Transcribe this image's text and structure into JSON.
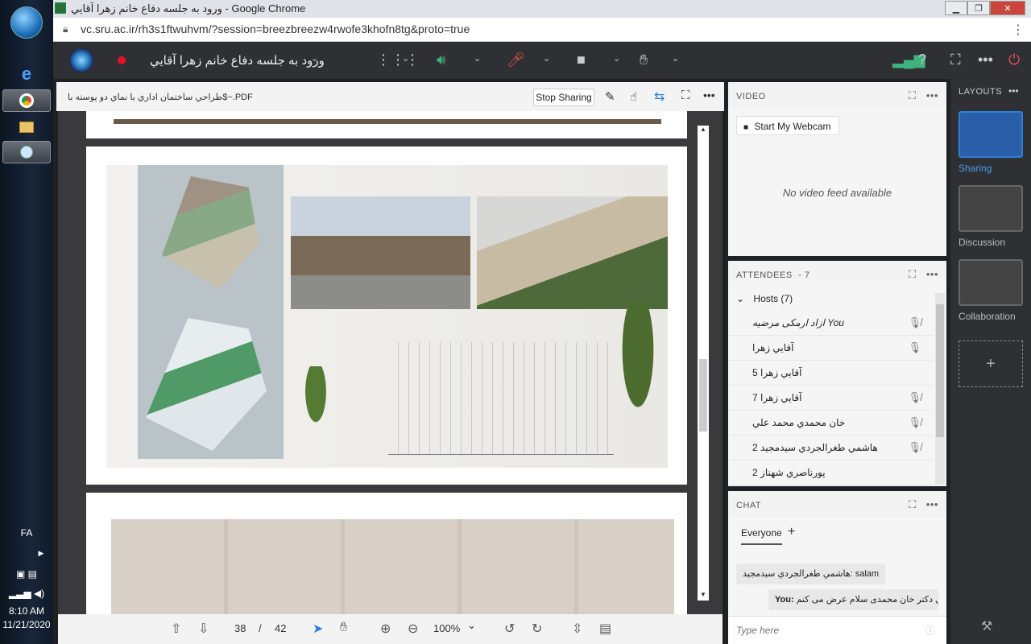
{
  "window": {
    "title": "ورود به جلسه دفاع خانم زهرا آقايي - Google Chrome",
    "url": "vc.sru.ac.ir/rh3s1ftwuhvm/?session=breezbreezw4rwofe3khofn8tg&proto=true"
  },
  "meeting": {
    "title": "ورود به جلسه دفاع خانم زهرا آقايي"
  },
  "share": {
    "filename": "طراحي ساختمان اداري با نماي دو پوسته با$~.PDF",
    "stop_label": "Stop Sharing",
    "page_current": "38",
    "page_sep": "/",
    "page_total": "42",
    "zoom": "100%"
  },
  "video": {
    "header": "VIDEO",
    "webcam_label": "Start My Webcam",
    "no_feed": "No video feed available"
  },
  "attendees": {
    "header": "ATTENDEES",
    "count": "- 7",
    "group": "Hosts (7)",
    "rows": [
      {
        "name": "ازاد ارمکی مرضیه You",
        "mic": "muted"
      },
      {
        "name": "آقايي زهرا",
        "mic": "on"
      },
      {
        "name": "آقايي زهرا 5",
        "mic": ""
      },
      {
        "name": "آقايي زهرا 7",
        "mic": "muted"
      },
      {
        "name": "خان محمدي محمد علي",
        "mic": "muted"
      },
      {
        "name": "هاشمي طغرالجردي سيدمجيد 2",
        "mic": "muted"
      },
      {
        "name": "پورناصري شهناز 2",
        "mic": ""
      }
    ]
  },
  "chat": {
    "header": "CHAT",
    "tab": "Everyone",
    "messages": [
      {
        "sender": "هاشمي طغرالجردي سيدمجيد:",
        "text": "salam"
      },
      {
        "sender": "You:",
        "text": "آقای دکتر خان محمدی سلام عرض می کنم"
      }
    ],
    "placeholder": "Type here"
  },
  "layouts": {
    "header": "LAYOUTS",
    "items": [
      "Sharing",
      "Discussion",
      "Collaboration"
    ]
  },
  "tray": {
    "lang": "FA",
    "time": "8:10 AM",
    "date": "11/21/2020"
  },
  "colors": {
    "accent": "#2e7fd6",
    "appbar": "#2f3033",
    "record": "#e81123",
    "mic_muted": "#e05252",
    "speaker": "#3fb37f"
  }
}
